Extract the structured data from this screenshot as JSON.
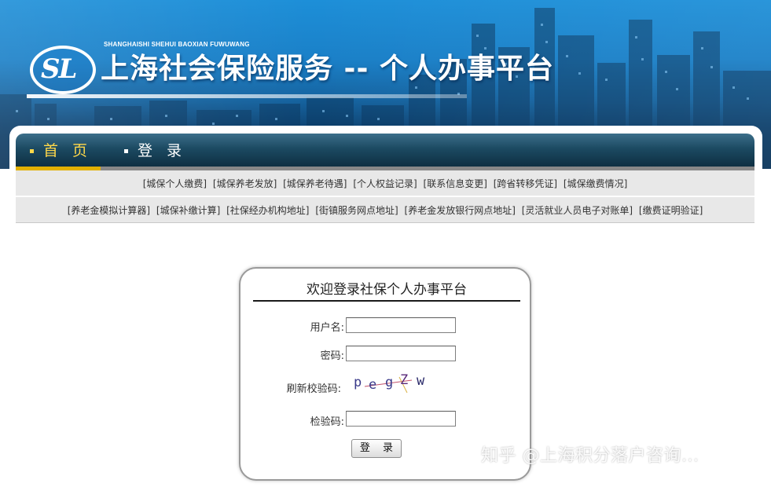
{
  "header": {
    "logo_text": "SL",
    "pinyin": "SHANGHAISHI SHEHUI BAOXIAN FUWUWANG",
    "title": "上海社会保险服务 -- 个人办事平台"
  },
  "nav": {
    "items": [
      {
        "label": "首 页",
        "active": true
      },
      {
        "label": "登 录",
        "active": false
      }
    ]
  },
  "links": {
    "row1": [
      "[城保个人缴费]",
      "[城保养老发放]",
      "[城保养老待遇]",
      "[个人权益记录]",
      "[联系信息变更]",
      "[跨省转移凭证]",
      "[城保缴费情况]"
    ],
    "row2": [
      "[养老金模拟计算器]",
      "[城保补缴计算]",
      "[社保经办机构地址]",
      "[街镇服务网点地址]",
      "[养老金发放银行网点地址]",
      "[灵活就业人员电子对账单]",
      "[缴费证明验证]"
    ]
  },
  "login": {
    "title": "欢迎登录社保个人办事平台",
    "username_label": "用户名:",
    "username_value": "",
    "password_label": "密码:",
    "password_value": "",
    "refresh_label": "刷新校验码:",
    "captcha_chars": [
      "p",
      "e",
      "g",
      "Z",
      "w"
    ],
    "code_label": "检验码:",
    "code_value": "",
    "submit_label": "登 录"
  },
  "watermark": "知乎 @上海积分落户咨询...",
  "colors": {
    "banner_top": "#1d8fd8",
    "nav_bar": "#1c4a62",
    "nav_active": "#ffd84a",
    "nav_active_underline": "#e2b000",
    "links_background": "#e8e8e8"
  }
}
